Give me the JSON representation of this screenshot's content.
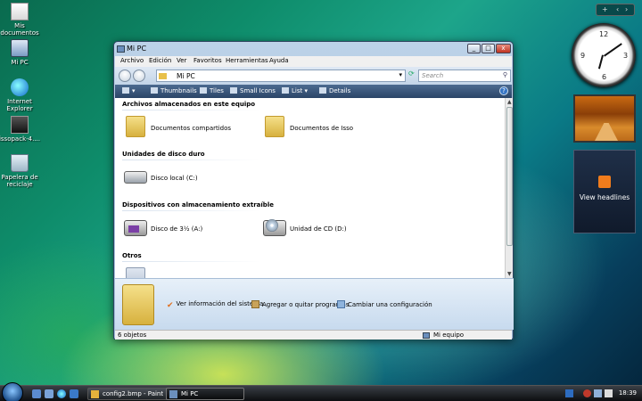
{
  "desktop": {
    "icons": [
      {
        "label": "Mis documentos",
        "icon": "documents-icon"
      },
      {
        "label": "Mi PC",
        "icon": "computer-icon"
      },
      {
        "label": "Internet Explorer",
        "icon": "internet-explorer-icon"
      },
      {
        "label": "issopack-4....",
        "icon": "application-icon"
      },
      {
        "label": "Papelera de reciclaje",
        "icon": "recycle-bin-icon"
      }
    ]
  },
  "sidebar": {
    "controls": [
      "+",
      "‹",
      "›"
    ],
    "feed_label": "View headlines",
    "clock_numbers": [
      "12",
      "3",
      "6",
      "9"
    ]
  },
  "window": {
    "title": "Mi PC",
    "menu": [
      "Archivo",
      "Edición",
      "Ver",
      "Favoritos",
      "Herramientas",
      "Ayuda"
    ],
    "address": "Mi PC",
    "search_placeholder": "Search",
    "toolbar": {
      "organize": "",
      "thumbnails": "Thumbnails",
      "tiles": "Tiles",
      "small_icons": "Small Icons",
      "list": "List",
      "details": "Details"
    },
    "groups": {
      "stored": {
        "title": "Archivos almacenados en este equipo",
        "items": [
          "Documentos compartidos",
          "Documentos de Isso"
        ]
      },
      "hdd": {
        "title": "Unidades de disco duro",
        "items": [
          "Disco local (C:)"
        ]
      },
      "removable": {
        "title": "Dispositivos con almacenamiento extraíble",
        "items": [
          "Disco de 3½ (A:)",
          "Unidad de CD (D:)"
        ]
      },
      "other": {
        "title": "Otros"
      }
    },
    "tasks": [
      "Ver información del sistema",
      "Agregar o quitar programas",
      "Cambiar una configuración"
    ],
    "status": {
      "count": "6 objetos",
      "location": "Mi equipo"
    }
  },
  "taskbar": {
    "buttons": [
      {
        "label": "config2.bmp - Paint",
        "active": false
      },
      {
        "label": "Mi PC",
        "active": true
      }
    ],
    "time": "18:39"
  },
  "colors": {
    "toolbar": "#2b4567",
    "selection": "#3574c4",
    "folder": "#e8c04a"
  }
}
